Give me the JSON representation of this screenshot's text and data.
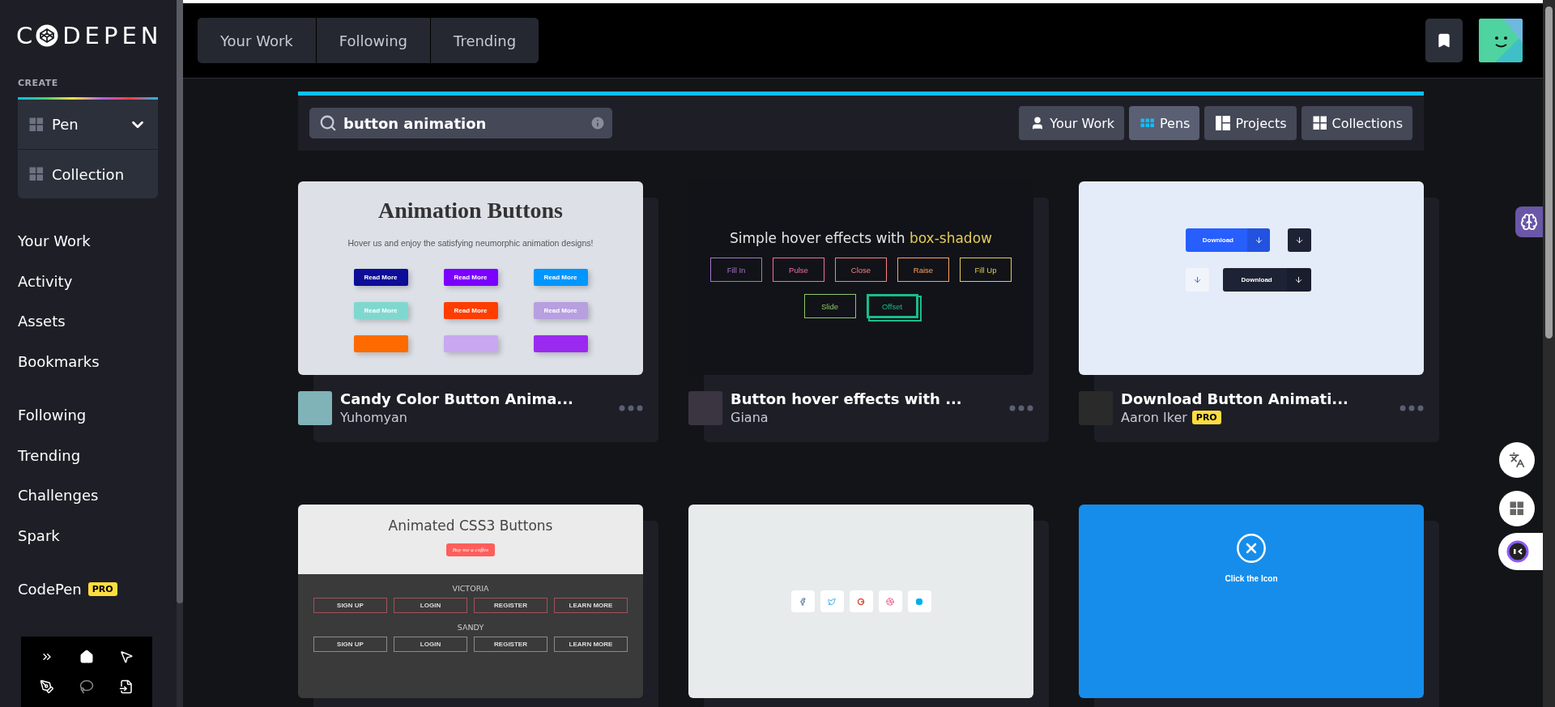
{
  "sidebar": {
    "logo": {
      "before": "C",
      "after": "DEPEN"
    },
    "create_label": "CREATE",
    "create_items": [
      {
        "label": "Pen",
        "kind": "dropdown"
      },
      {
        "label": "Collection",
        "kind": "plain"
      }
    ],
    "nav_groups": [
      {
        "items": [
          {
            "label": "Your Work"
          },
          {
            "label": "Activity"
          },
          {
            "label": "Assets"
          },
          {
            "label": "Bookmarks"
          }
        ]
      },
      {
        "items": [
          {
            "label": "Following"
          },
          {
            "label": "Trending"
          },
          {
            "label": "Challenges"
          },
          {
            "label": "Spark"
          }
        ]
      },
      {
        "items": [
          {
            "label": "CodePen",
            "badge": "PRO"
          }
        ]
      }
    ]
  },
  "top_tabs": [
    {
      "label": "Your Work"
    },
    {
      "label": "Following"
    },
    {
      "label": "Trending"
    }
  ],
  "search": {
    "value": "button animation"
  },
  "filters": [
    {
      "label": "Your Work",
      "kind": "user",
      "selected": false
    },
    {
      "label": "Pens",
      "kind": "pens",
      "selected": true
    },
    {
      "label": "Projects",
      "kind": "projects",
      "selected": false
    },
    {
      "label": "Collections",
      "kind": "collections",
      "selected": false
    }
  ],
  "cards": [
    {
      "title": "Candy Color Button Anima...",
      "author": "Yuhomyan",
      "preview": {
        "kind": "neumorphic",
        "heading": "Animation Buttons",
        "text": "Hover us and enjoy the satisfying neumorphic animation designs!",
        "buttons": [
          {
            "label": "Read More",
            "color": "#0d0d98"
          },
          {
            "label": "Read More",
            "color": "#7b00ff"
          },
          {
            "label": "Read More",
            "color": "#0096ff"
          },
          {
            "label": "Read More",
            "color": "#7fd8d0"
          },
          {
            "label": "Read More",
            "color": "#ff3d00"
          },
          {
            "label": "Read More",
            "color": "#b89fe0"
          }
        ],
        "cut_buttons": [
          {
            "color": "#ff6a00"
          },
          {
            "color": "#c8a8f0"
          },
          {
            "color": "#9a2af0"
          }
        ]
      }
    },
    {
      "title": "Button hover effects with ...",
      "author": "Giana",
      "preview": {
        "kind": "hover",
        "heading": "Simple hover effects with",
        "highlight": "box-shadow",
        "buttons": [
          {
            "label": "Fill In",
            "color": "#a972cb",
            "hovered": false
          },
          {
            "label": "Pulse",
            "color": "#ef6eae",
            "hovered": false
          },
          {
            "label": "Close",
            "color": "#ff7f82",
            "hovered": false
          },
          {
            "label": "Raise",
            "color": "#ffa260",
            "hovered": false
          },
          {
            "label": "Fill Up",
            "color": "#e4cb58",
            "hovered": false
          },
          {
            "label": "Slide",
            "color": "#8fc866",
            "hovered": false
          },
          {
            "label": "Offset",
            "color": "#19bc8b",
            "hovered": true
          }
        ]
      }
    },
    {
      "title": "Download Button Animati...",
      "author": "Aaron Iker",
      "badge": "PRO",
      "preview": {
        "kind": "download",
        "buttons": [
          {
            "kind": "primary",
            "label": "Download"
          },
          {
            "kind": "dark-icon"
          },
          {
            "kind": "light-icon"
          },
          {
            "kind": "dark",
            "label": "Download"
          }
        ]
      }
    },
    {
      "preview": {
        "kind": "css3",
        "heading": "Animated CSS3 Buttons",
        "button": "Buy me a coffee",
        "sections": [
          {
            "name": "VICTORIA",
            "color": "#a0525a",
            "buttons": [
              "SIGN UP",
              "LOGIN",
              "REGISTER",
              "LEARN MORE"
            ]
          },
          {
            "name": "SANDY",
            "color": "#8a8a8a",
            "buttons": [
              "SIGN UP",
              "LOGIN",
              "REGISTER",
              "LEARN MORE"
            ]
          }
        ]
      }
    },
    {
      "preview": {
        "kind": "social"
      }
    },
    {
      "preview": {
        "kind": "click-icon",
        "caption": "Click the Icon"
      }
    }
  ]
}
